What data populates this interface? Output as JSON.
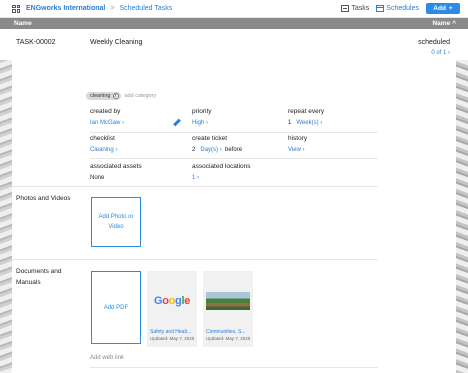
{
  "nav": {
    "org": "ENGworks International",
    "separator": ">",
    "section": "Scheduled Tasks",
    "tasks_label": "Tasks",
    "schedules_label": "Schedules",
    "add_label": "Add",
    "add_symbol": "+"
  },
  "column_header": {
    "left": "Name",
    "right": "Name",
    "sort_arrow": "^"
  },
  "task": {
    "id": "TASK-00002",
    "name": "Weekly Cleaning",
    "status": "scheduled",
    "status_sub": "0 of 1",
    "chevron": "›"
  },
  "tags": {
    "chip": "cleaning",
    "chip_remove": "x",
    "add_placeholder": "add category"
  },
  "fields": {
    "created_by": {
      "label": "created by",
      "value": "Ian McGaw"
    },
    "priority": {
      "label": "priority",
      "value": "High"
    },
    "repeat_every": {
      "label": "repeat every",
      "number": "1",
      "unit": "Week(s)"
    },
    "checklist": {
      "label": "checklist",
      "value": "Cleaning"
    },
    "create_ticket": {
      "label": "create ticket",
      "number": "2",
      "unit": "Day(s)",
      "suffix": "before"
    },
    "history": {
      "label": "history",
      "value": "View"
    },
    "associated_assets": {
      "label": "associated assets",
      "value": "None"
    },
    "associated_locations": {
      "label": "associated locations",
      "value": "1"
    }
  },
  "photos": {
    "title": "Photos and Videos",
    "add_label": "Add Photo or Video"
  },
  "documents": {
    "title": "Documents and Manuals",
    "add_label": "Add PDF",
    "items": [
      {
        "title": "Safety and Healt...",
        "date": "Updated: May 7, 2020",
        "thumb": "google-logo"
      },
      {
        "title": "Communities, S...",
        "date": "Updated: May 7, 2020",
        "thumb": "landscape-photo"
      }
    ],
    "add_web_link": "Add web link"
  },
  "colors": {
    "accent": "#2a8ce6",
    "link": "#2a7fd4",
    "header_bar": "#8a8a8a"
  }
}
